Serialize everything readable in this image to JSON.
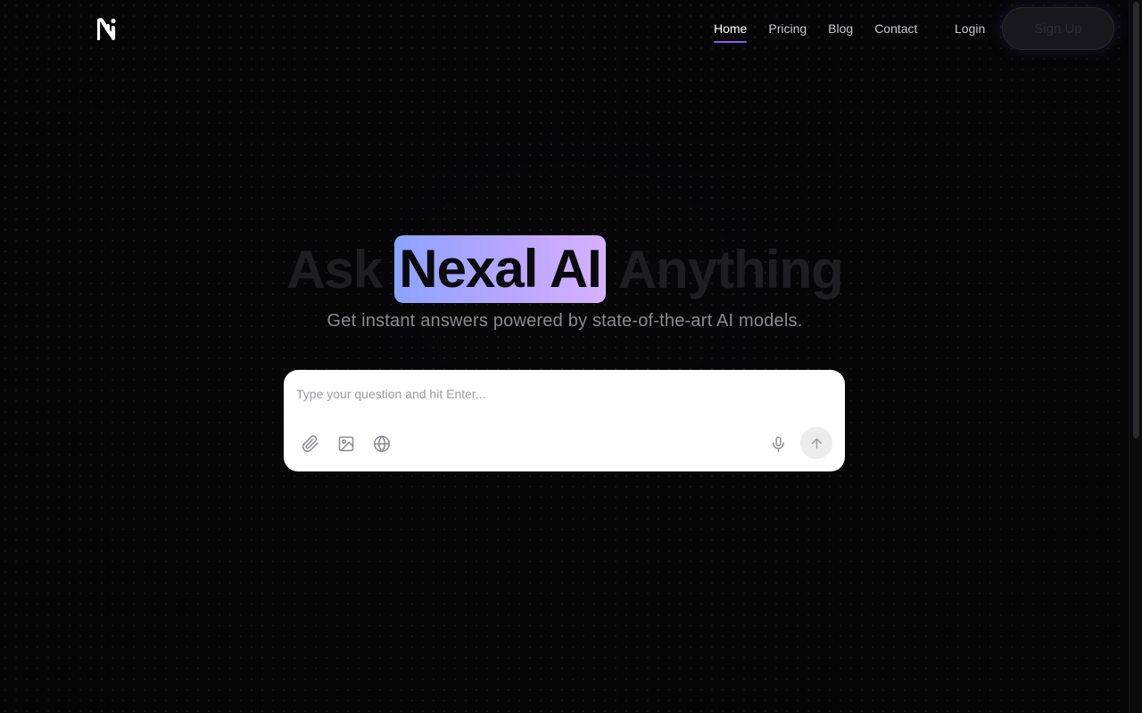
{
  "nav": {
    "items": [
      {
        "label": "Home",
        "active": true
      },
      {
        "label": "Pricing",
        "active": false
      },
      {
        "label": "Blog",
        "active": false
      },
      {
        "label": "Contact",
        "active": false
      }
    ],
    "login_label": "Login",
    "signup_label": "Sign Up"
  },
  "hero": {
    "title_prefix": "Ask",
    "title_highlight": "Nexal AI",
    "title_suffix": "Anything",
    "subtitle": "Get instant answers powered by state-of-the-art AI models."
  },
  "chat": {
    "placeholder": "Type your question and hit Enter...",
    "tools": [
      "paperclip-icon",
      "image-icon",
      "globe-icon"
    ],
    "mic_icon": "microphone-icon",
    "send_icon": "arrow-up-icon"
  },
  "colors": {
    "accent": "#8b5cf6",
    "highlight_start": "#8aa4ff",
    "highlight_end": "#d6b1ff",
    "background": "#070708"
  }
}
